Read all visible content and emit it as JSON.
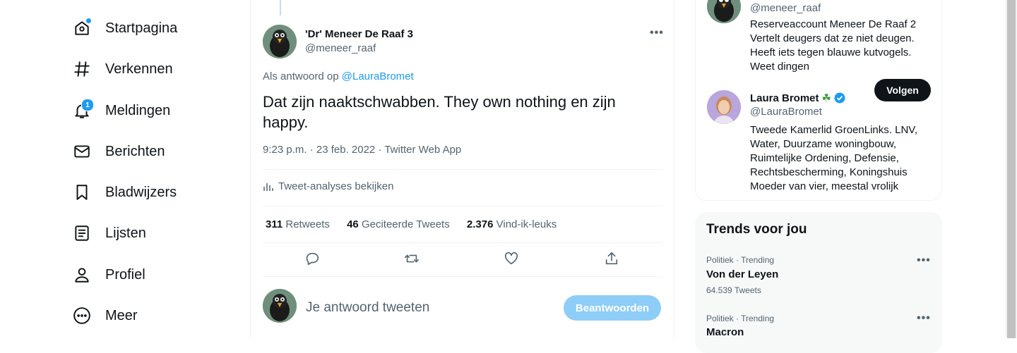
{
  "nav": {
    "items": [
      {
        "label": "Startpagina",
        "icon": "home-icon",
        "badge": ""
      },
      {
        "label": "Verkennen",
        "icon": "hashtag-icon",
        "badge": ""
      },
      {
        "label": "Meldingen",
        "icon": "bell-icon",
        "badge": "1"
      },
      {
        "label": "Berichten",
        "icon": "mail-icon",
        "badge": ""
      },
      {
        "label": "Bladwijzers",
        "icon": "bookmark-icon",
        "badge": ""
      },
      {
        "label": "Lijsten",
        "icon": "list-icon",
        "badge": ""
      },
      {
        "label": "Profiel",
        "icon": "profile-icon",
        "badge": ""
      },
      {
        "label": "Meer",
        "icon": "more-circle-icon",
        "badge": ""
      }
    ]
  },
  "tweet": {
    "author_name": "'Dr' Meneer De Raaf 3",
    "author_handle": "@meneer_raaf",
    "reply_prefix": "Als antwoord op",
    "reply_mention": "@LauraBromet",
    "text": "Dat zijn naaktschwabben. They own nothing en zijn happy.",
    "meta": "9:23 p.m. · 23 feb. 2022 · Twitter Web App",
    "analytics": "Tweet-analyses bekijken",
    "stats": {
      "retweets_count": "311",
      "retweets_label": "Retweets",
      "quotes_count": "46",
      "quotes_label": "Geciteerde Tweets",
      "likes_count": "2.376",
      "likes_label": "Vind-ik-leuks"
    }
  },
  "reply_box": {
    "placeholder": "Je antwoord tweeten",
    "button": "Beantwoorden"
  },
  "who_to_follow": {
    "account1": {
      "handle": "@meneer_raaf",
      "bio": [
        "Reserveaccount Meneer De Raaf 2",
        "Vertelt deugers dat ze niet deugen.",
        "Heeft iets tegen blauwe kutvogels.",
        "Weet dingen"
      ]
    },
    "account2": {
      "name": "Laura Bromet",
      "handle": "@LauraBromet",
      "follow_label": "Volgen",
      "bio": [
        "Tweede Kamerlid GroenLinks. LNV,",
        "Water, Duurzame woningbouw,",
        "Ruimtelijke Ordening, Defensie,",
        "Rechtsbescherming, Koningshuis",
        "Moeder van vier, meestal vrolijk"
      ]
    }
  },
  "trends": {
    "title": "Trends voor jou",
    "items": [
      {
        "meta": "Politiek · Trending",
        "name": "Von der Leyen",
        "count": "64.539 Tweets"
      },
      {
        "meta": "Politiek · Trending",
        "name": "Macron",
        "count": ""
      }
    ]
  },
  "colors": {
    "accent": "#1d9bf0",
    "text": "#0f1419",
    "muted": "#536471",
    "reply_button": "#8ecdf7"
  }
}
